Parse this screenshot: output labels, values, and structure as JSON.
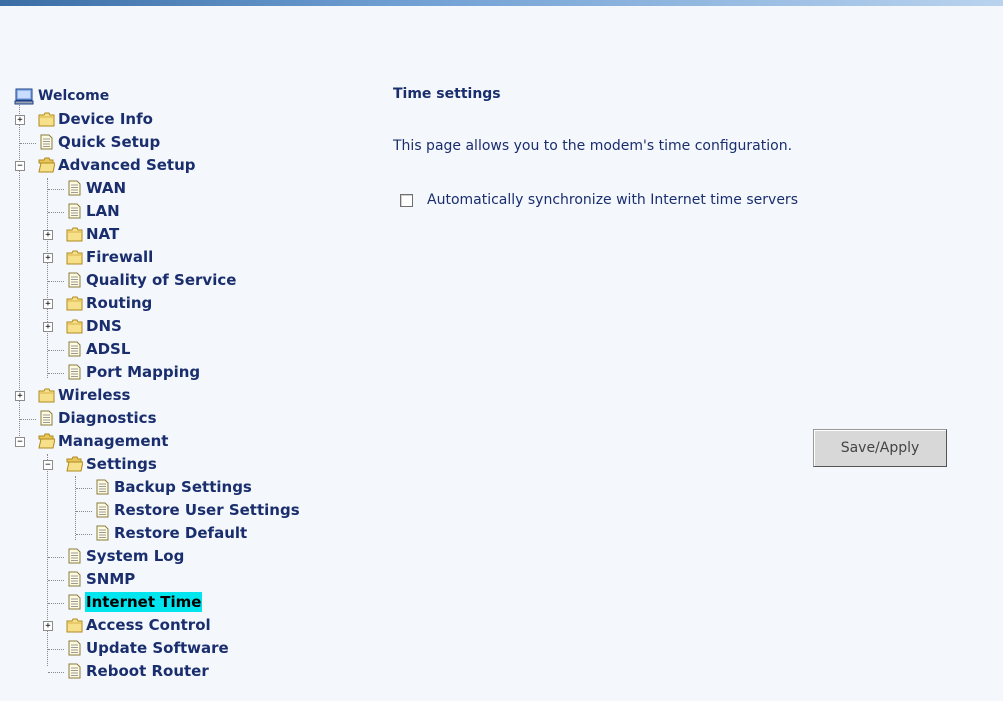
{
  "tree": {
    "welcome": "Welcome",
    "device_info": "Device Info",
    "quick_setup": "Quick Setup",
    "advanced_setup": "Advanced Setup",
    "wan": "WAN",
    "lan": "LAN",
    "nat": "NAT",
    "firewall": "Firewall",
    "qos": "Quality of Service",
    "routing": "Routing",
    "dns": "DNS",
    "adsl": "ADSL",
    "port_mapping": "Port Mapping",
    "wireless": "Wireless",
    "diagnostics": "Diagnostics",
    "management": "Management",
    "settings": "Settings",
    "backup_settings": "Backup Settings",
    "restore_user_settings": "Restore User Settings",
    "restore_default": "Restore Default",
    "system_log": "System Log",
    "snmp": "SNMP",
    "internet_time": "Internet Time",
    "access_control": "Access Control",
    "update_software": "Update Software",
    "reboot_router": "Reboot Router",
    "expand_glyph": "+",
    "collapse_glyph": "−"
  },
  "content": {
    "title": "Time settings",
    "description": "This page allows you to the modem's time configuration.",
    "sync_label": "Automatically synchronize with Internet time servers",
    "sync_checked": false,
    "save_button": "Save/Apply"
  },
  "colors": {
    "label_text": "#1a2e6e",
    "selected_highlight": "#00e5ee",
    "folder_fill": "#f7e08a",
    "folder_stroke": "#b08a1e"
  },
  "icons": {
    "root": "computer-icon",
    "folder": "folder-icon",
    "open_folder": "folder-open-icon",
    "page": "page-icon"
  }
}
